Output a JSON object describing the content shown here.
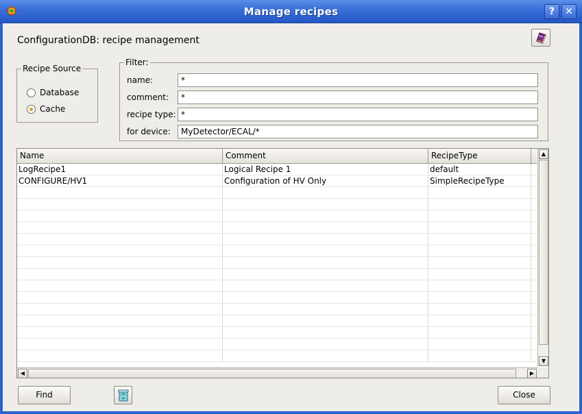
{
  "window": {
    "title": "Manage recipes",
    "help_label": "?",
    "close_label": "✕",
    "accent_color": "#2b63cf"
  },
  "header": {
    "title": "ConfigurationDB: recipe management",
    "help_book_icon": "book-icon"
  },
  "recipe_source": {
    "legend": "Recipe Source",
    "options": [
      {
        "label": "Database",
        "checked": false
      },
      {
        "label": "Cache",
        "checked": true
      }
    ]
  },
  "filter": {
    "legend": "Filter:",
    "fields": [
      {
        "label": "name:",
        "value": "*"
      },
      {
        "label": "comment:",
        "value": "*"
      },
      {
        "label": "recipe type:",
        "value": "*"
      },
      {
        "label": "for device:",
        "value": "MyDetector/ECAL/*"
      }
    ]
  },
  "table": {
    "columns": [
      "Name",
      "Comment",
      "RecipeType"
    ],
    "rows": [
      [
        "LogRecipe1",
        "Logical Recipe 1",
        "default"
      ],
      [
        "CONFIGURE/HV1",
        "Configuration of HV Only",
        "SimpleRecipeType"
      ]
    ],
    "empty_rows": 15
  },
  "buttons": {
    "find_label": "Find",
    "clear_icon": "recycle-bin-icon",
    "close_label": "Close"
  }
}
